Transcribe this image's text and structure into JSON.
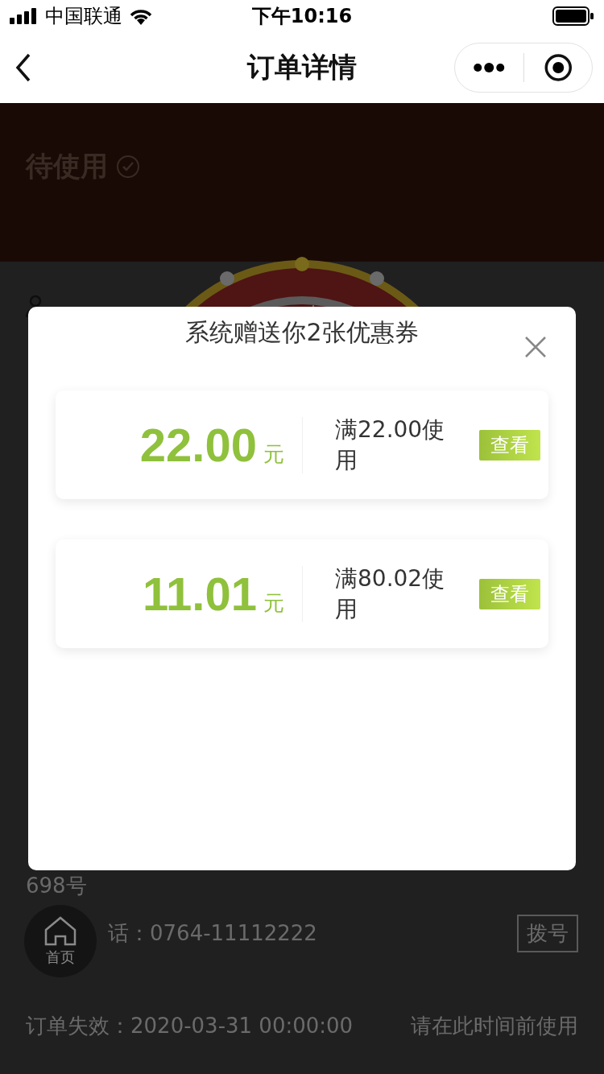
{
  "status_bar": {
    "carrier": "中国联通",
    "time": "下午10:16"
  },
  "nav": {
    "title": "订单详情"
  },
  "header": {
    "status": "待使用"
  },
  "store": {
    "address_tail": "698号",
    "phone": "话：0764-11112222",
    "dial_button": "拨号"
  },
  "expiry": {
    "label": "订单失效：2020-03-31 00:00:00",
    "hint": "请在此时间前使用"
  },
  "home_button": {
    "label": "首页"
  },
  "coupon_dialog": {
    "title": "系统赠送你2张优惠券",
    "coupons": [
      {
        "amount": "22.00",
        "unit": "元",
        "condition": "满22.00使用",
        "button": "查看"
      },
      {
        "amount": "11.01",
        "unit": "元",
        "condition": "满80.02使用",
        "button": "查看"
      }
    ]
  }
}
